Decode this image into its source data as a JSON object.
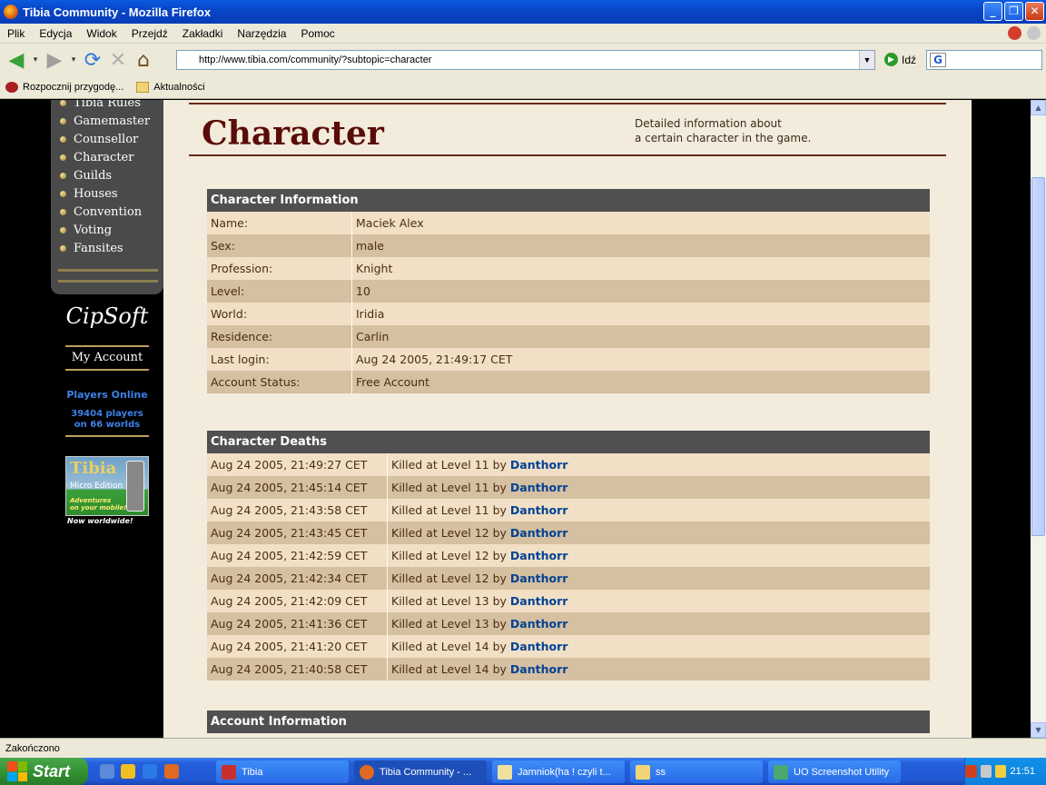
{
  "window": {
    "title": "Tibia Community - Mozilla Firefox",
    "buttons": [
      "_",
      "❐",
      "✕"
    ]
  },
  "menu": [
    "Plik",
    "Edycja",
    "Widok",
    "Przejdź",
    "Zakładki",
    "Narzędzia",
    "Pomoc"
  ],
  "navbar": {
    "url": "http://www.tibia.com/community/?subtopic=character",
    "go_label": "Idź"
  },
  "bookmarks": [
    {
      "label": "Rozpocznij przygodę...",
      "icon": "firefox-icon"
    },
    {
      "label": "Aktualności",
      "icon": "folder-icon"
    }
  ],
  "leftnav": {
    "items": [
      "Tibia Rules",
      "Gamemaster",
      "Counsellor",
      "Character",
      "Guilds",
      "Houses",
      "Convention",
      "Voting",
      "Fansites"
    ]
  },
  "sidebar": {
    "brand": "CipSoft",
    "my_account": "My Account",
    "players_online_label": "Players Online",
    "players_line1": "39404 players",
    "players_line2": "on 66 worlds",
    "banner_title": "Tibia",
    "banner_sub": "Micro Edition",
    "banner_tag1": "Adventures",
    "banner_tag2": "on your mobile!",
    "banner_worldwide": "Now worldwide!"
  },
  "page": {
    "heading": "Character",
    "desc_line1": "Detailed information about",
    "desc_line2": "a certain character in the game."
  },
  "character_info": {
    "title": "Character Information",
    "rows": [
      {
        "label": "Name:",
        "value": "Maciek Alex"
      },
      {
        "label": "Sex:",
        "value": "male"
      },
      {
        "label": "Profession:",
        "value": "Knight"
      },
      {
        "label": "Level:",
        "value": "10"
      },
      {
        "label": "World:",
        "value": "Iridia"
      },
      {
        "label": "Residence:",
        "value": "Carlin"
      },
      {
        "label": "Last login:",
        "value": "Aug 24 2005, 21:49:17 CET"
      },
      {
        "label": "Account Status:",
        "value": "Free Account"
      }
    ]
  },
  "deaths": {
    "title": "Character Deaths",
    "rows": [
      {
        "date": "Aug 24 2005, 21:49:27 CET",
        "text": "Killed at Level 11 by",
        "killer": "Danthorr"
      },
      {
        "date": "Aug 24 2005, 21:45:14 CET",
        "text": "Killed at Level 11 by",
        "killer": "Danthorr"
      },
      {
        "date": "Aug 24 2005, 21:43:58 CET",
        "text": "Killed at Level 11 by",
        "killer": "Danthorr"
      },
      {
        "date": "Aug 24 2005, 21:43:45 CET",
        "text": "Killed at Level 12 by",
        "killer": "Danthorr"
      },
      {
        "date": "Aug 24 2005, 21:42:59 CET",
        "text": "Killed at Level 12 by",
        "killer": "Danthorr"
      },
      {
        "date": "Aug 24 2005, 21:42:34 CET",
        "text": "Killed at Level 12 by",
        "killer": "Danthorr"
      },
      {
        "date": "Aug 24 2005, 21:42:09 CET",
        "text": "Killed at Level 13 by",
        "killer": "Danthorr"
      },
      {
        "date": "Aug 24 2005, 21:41:36 CET",
        "text": "Killed at Level 13 by",
        "killer": "Danthorr"
      },
      {
        "date": "Aug 24 2005, 21:41:20 CET",
        "text": "Killed at Level 14 by",
        "killer": "Danthorr"
      },
      {
        "date": "Aug 24 2005, 21:40:58 CET",
        "text": "Killed at Level 14 by",
        "killer": "Danthorr"
      }
    ]
  },
  "account_info": {
    "title": "Account Information"
  },
  "status": "Zakończono",
  "taskbar": {
    "start": "Start",
    "tasks": [
      {
        "label": "Tibia"
      },
      {
        "label": "Tibia Community - ..."
      },
      {
        "label": "Jamniok(ha ! czyli t..."
      },
      {
        "label": "ss"
      },
      {
        "label": "UO Screenshot Utility"
      }
    ],
    "clock": "21:51"
  },
  "colors": {
    "titlebar": "#0846c8",
    "header_row": "#505050",
    "row_light": "#f1e0c6",
    "row_dark": "#d5c0a1",
    "heading": "#5a0c08",
    "killer_link": "#004294"
  }
}
